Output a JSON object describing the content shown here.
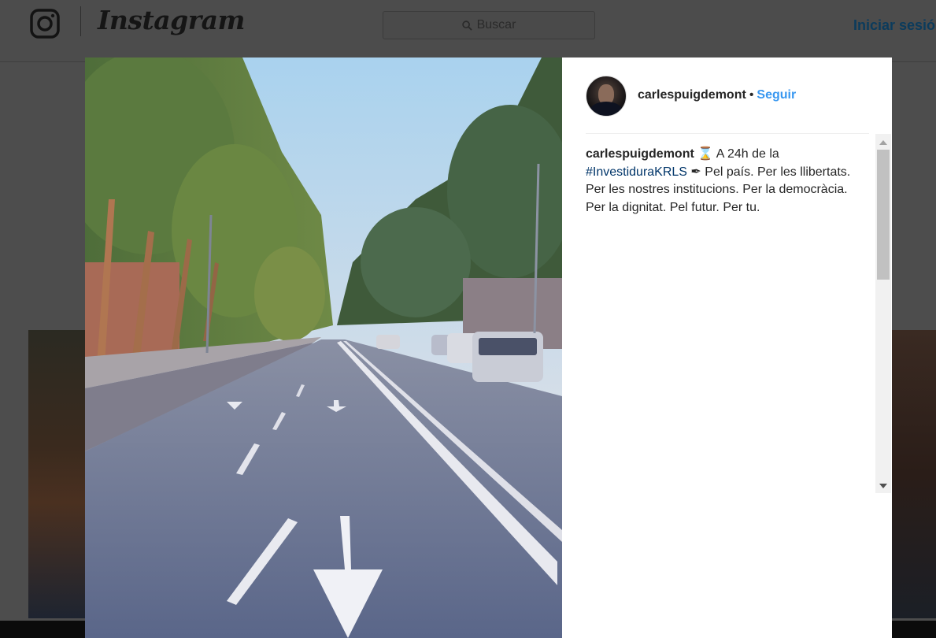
{
  "nav": {
    "brand": "Instagram",
    "search_placeholder": "Buscar",
    "login_label": "Iniciar sesió"
  },
  "post": {
    "username": "carlespuigdemont",
    "separator": "•",
    "follow_label": "Seguir",
    "caption": {
      "username": "carlespuigdemont",
      "text_before_hashtag": " ⌛ A 24h de la ",
      "hashtag": "#InvestiduraKRLS",
      "text_after_hashtag": " ✒ Pel país. Per les llibertats. Per les nostres institucions. Per la democràcia. Per la dignitat. Pel futur. Per tu."
    }
  },
  "colors": {
    "link_blue": "#3897f0",
    "hashtag_blue": "#003569",
    "text": "#262626",
    "overlay": "#4d4d4d"
  },
  "icons": {
    "logo": "instagram-camera-icon",
    "search": "search-icon",
    "scroll_up": "arrow-up-icon",
    "scroll_down": "arrow-down-icon"
  }
}
